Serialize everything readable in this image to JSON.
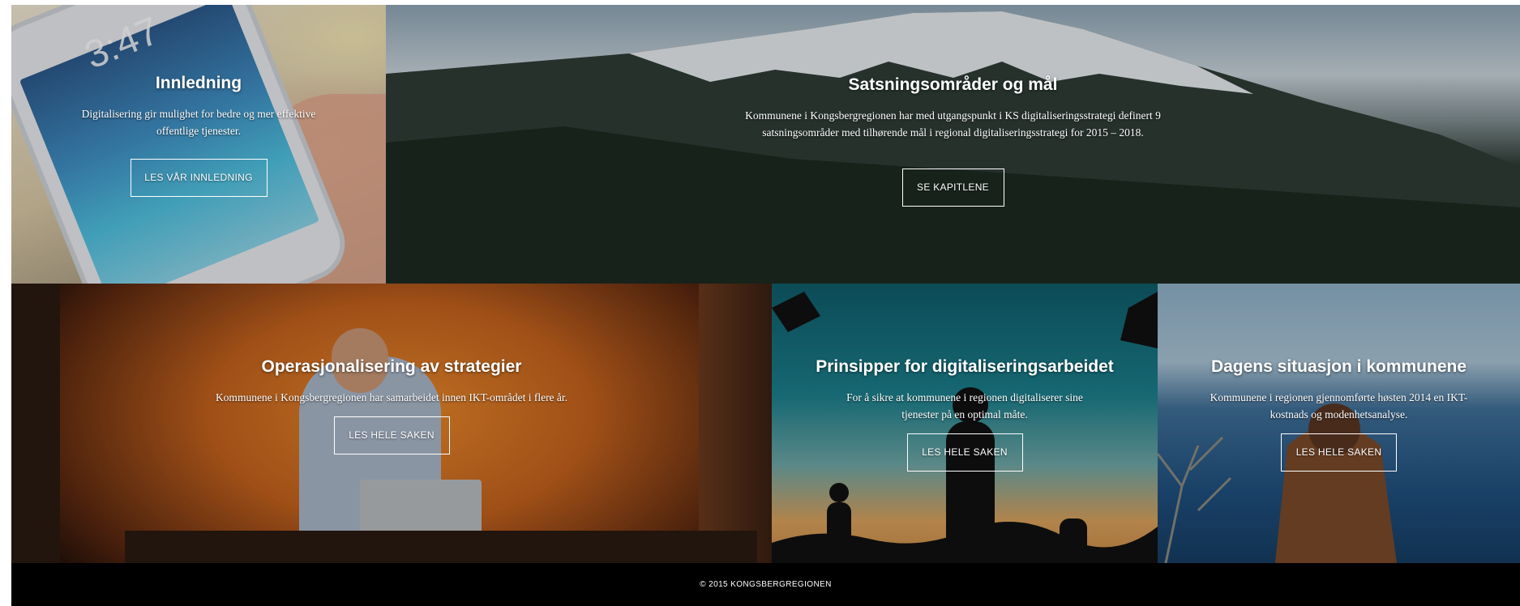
{
  "tiles": [
    {
      "title": "Innledning",
      "text": "Digitalisering gir mulighet for bedre og mer effektive offentlige tjenester.",
      "button": "LES VÅR INNLEDNING"
    },
    {
      "title": "Satsningsområder og mål",
      "text": "Kommunene i Kongsbergregionen har med utgangspunkt i KS digitaliseringsstrategi definert 9 satsningsområder med tilhørende mål i regional digitaliseringsstrategi for 2015 – 2018.",
      "button": "SE KAPITLENE"
    },
    {
      "title": "Operasjonalisering av strategier",
      "text": "Kommunene i Kongsbergregionen har samarbeidet innen IKT-området i flere år.",
      "button": "LES HELE SAKEN"
    },
    {
      "title": "Prinsipper for digitaliseringsarbeidet",
      "text": "For å sikre at kommunene i regionen digitaliserer sine tjenester på en optimal måte.",
      "button": "LES HELE SAKEN"
    },
    {
      "title": "Dagens situasjon i kommunene",
      "text": "Kommunene i regionen gjennomførte høsten 2014 en IKT-kostnads og modenhetsanalyse.",
      "button": "LES HELE SAKEN"
    }
  ],
  "phone": {
    "clock": "3:47"
  },
  "footer": {
    "copyright": "© 2015 KONGSBERGREGIONEN"
  }
}
